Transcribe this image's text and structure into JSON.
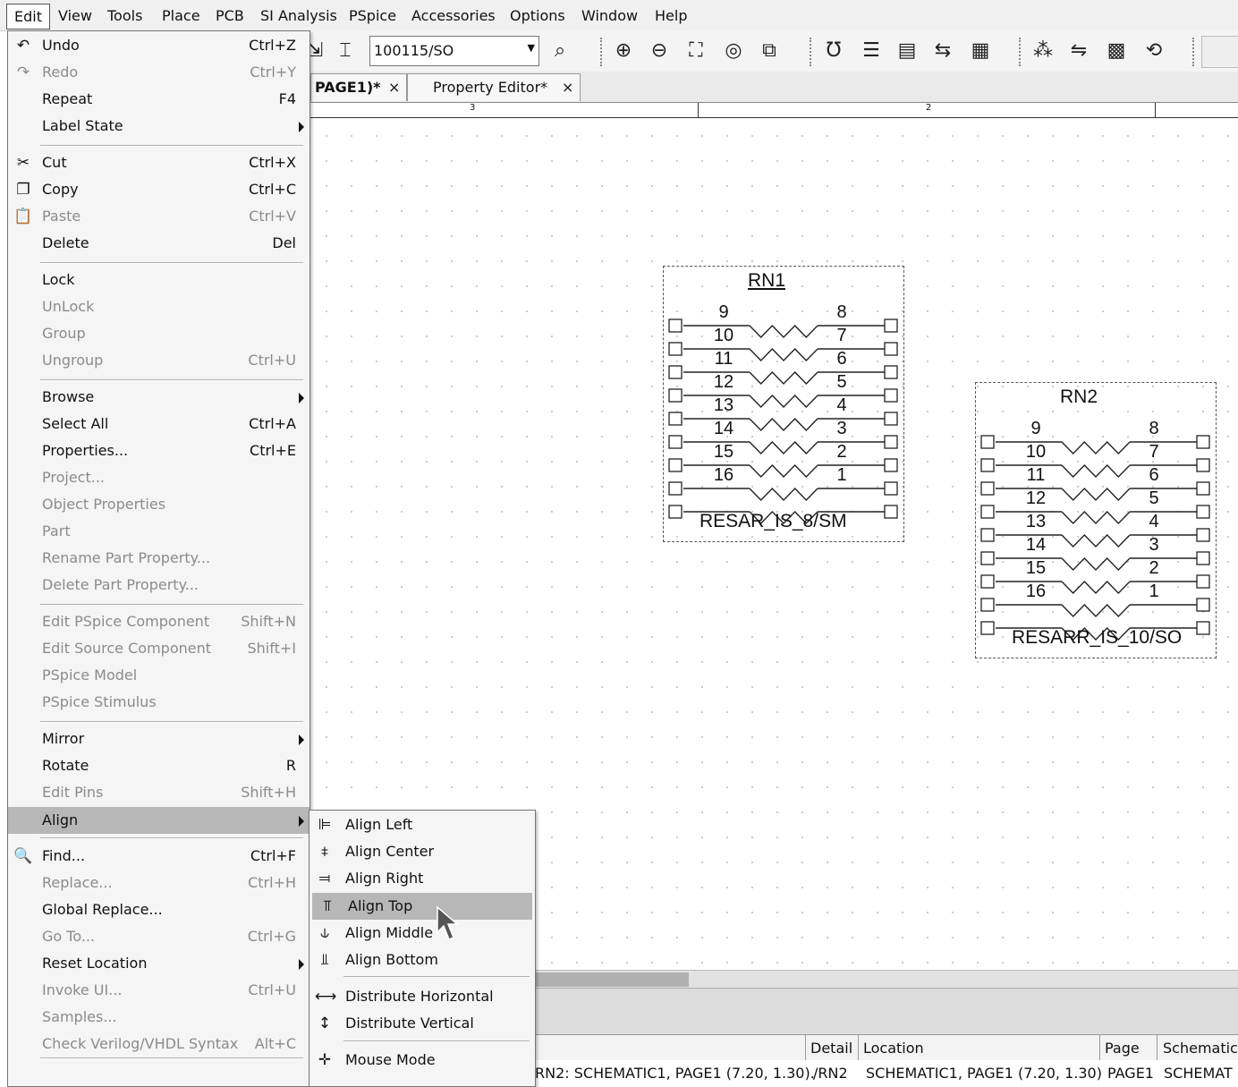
{
  "menubar": {
    "items": [
      "Edit",
      "View",
      "Tools",
      "Place",
      "PCB",
      "SI Analysis",
      "PSpice",
      "Accessories",
      "Options",
      "Window",
      "Help"
    ]
  },
  "toolbar": {
    "part_combo_value": "100115/SO",
    "icons": [
      "place-part-icon",
      "place-pin-icon",
      "find-part-icon",
      "zoom-in-icon",
      "zoom-out-icon",
      "zoom-area-icon",
      "zoom-all-icon",
      "zoom-region-icon",
      "annotate-icon",
      "backannotate-icon",
      "drc-icon",
      "netlist-icon",
      "bom-icon",
      "cross-probe-icon",
      "pcb-editor-icon",
      "constraint-manager-icon",
      "update-icon"
    ]
  },
  "tabs": [
    {
      "label": "PAGE1)*",
      "close": "×"
    },
    {
      "label": "Property Editor*",
      "close": "×"
    }
  ],
  "ruler": {
    "labels": [
      "3",
      "2"
    ]
  },
  "parts": [
    {
      "refdes": "RN1",
      "name": "RESAR_IS_8/SM",
      "left_pins": [
        "9",
        "10",
        "11",
        "12",
        "13",
        "14",
        "15",
        "16"
      ],
      "right_pins": [
        "8",
        "7",
        "6",
        "5",
        "4",
        "3",
        "2",
        "1"
      ]
    },
    {
      "refdes": "RN2",
      "name": "RESARR_IS_10/SO",
      "left_pins": [
        "9",
        "10",
        "11",
        "12",
        "13",
        "14",
        "15",
        "16"
      ],
      "right_pins": [
        "8",
        "7",
        "6",
        "5",
        "4",
        "3",
        "2",
        "1"
      ]
    }
  ],
  "edit_menu": {
    "items": [
      {
        "label": "Undo",
        "shortcut": "Ctrl+Z",
        "icon": "↶",
        "disabled": false
      },
      {
        "label": "Redo",
        "shortcut": "Ctrl+Y",
        "icon": "↷",
        "disabled": true
      },
      {
        "label": "Repeat",
        "shortcut": "F4",
        "disabled": false
      },
      {
        "label": "Label State",
        "shortcut": "",
        "submenu": true,
        "disabled": false
      },
      {
        "label": "Cut",
        "shortcut": "Ctrl+X",
        "icon": "✂",
        "disabled": false
      },
      {
        "label": "Copy",
        "shortcut": "Ctrl+C",
        "icon": "❐",
        "disabled": false
      },
      {
        "label": "Paste",
        "shortcut": "Ctrl+V",
        "icon": "📋",
        "disabled": true
      },
      {
        "label": "Delete",
        "shortcut": "Del",
        "disabled": false
      },
      {
        "label": "Lock",
        "shortcut": "",
        "disabled": false
      },
      {
        "label": "UnLock",
        "shortcut": "",
        "disabled": true
      },
      {
        "label": "Group",
        "shortcut": "",
        "disabled": true
      },
      {
        "label": "Ungroup",
        "shortcut": "Ctrl+U",
        "disabled": true
      },
      {
        "label": "Browse",
        "shortcut": "",
        "submenu": true,
        "disabled": false
      },
      {
        "label": "Select All",
        "shortcut": "Ctrl+A",
        "disabled": false
      },
      {
        "label": "Properties...",
        "shortcut": "Ctrl+E",
        "disabled": false
      },
      {
        "label": "Project...",
        "shortcut": "",
        "disabled": true
      },
      {
        "label": "Object Properties",
        "shortcut": "",
        "disabled": true
      },
      {
        "label": "Part",
        "shortcut": "",
        "disabled": true
      },
      {
        "label": "Rename Part Property...",
        "shortcut": "",
        "disabled": true
      },
      {
        "label": "Delete Part Property...",
        "shortcut": "",
        "disabled": true
      },
      {
        "label": "Edit PSpice Component",
        "shortcut": "Shift+N",
        "disabled": true
      },
      {
        "label": "Edit Source Component",
        "shortcut": "Shift+I",
        "disabled": true
      },
      {
        "label": "PSpice Model",
        "shortcut": "",
        "disabled": true
      },
      {
        "label": "PSpice Stimulus",
        "shortcut": "",
        "disabled": true
      },
      {
        "label": "Mirror",
        "shortcut": "",
        "submenu": true,
        "disabled": false
      },
      {
        "label": "Rotate",
        "shortcut": "R",
        "disabled": false
      },
      {
        "label": "Edit Pins",
        "shortcut": "Shift+H",
        "disabled": true
      },
      {
        "label": "Align",
        "shortcut": "",
        "submenu": true,
        "disabled": false,
        "highlighted": true
      },
      {
        "label": "Find...",
        "shortcut": "Ctrl+F",
        "icon": "🔍",
        "disabled": false
      },
      {
        "label": "Replace...",
        "shortcut": "Ctrl+H",
        "disabled": true
      },
      {
        "label": "Global Replace...",
        "shortcut": "",
        "disabled": false
      },
      {
        "label": "Go To...",
        "shortcut": "Ctrl+G",
        "disabled": true
      },
      {
        "label": "Reset Location",
        "shortcut": "",
        "submenu": true,
        "disabled": false
      },
      {
        "label": "Invoke UI...",
        "shortcut": "Ctrl+U",
        "disabled": true
      },
      {
        "label": "Samples...",
        "shortcut": "",
        "disabled": true
      },
      {
        "label": "Check Verilog/VHDL Syntax",
        "shortcut": "Alt+C",
        "disabled": true
      }
    ]
  },
  "align_menu": {
    "items": [
      {
        "label": "Align Left",
        "icon": "align-left-icon"
      },
      {
        "label": "Align Center",
        "icon": "align-center-icon"
      },
      {
        "label": "Align Right",
        "icon": "align-right-icon"
      },
      {
        "label": "Align Top",
        "icon": "align-top-icon",
        "highlighted": true
      },
      {
        "label": "Align Middle",
        "icon": "align-middle-icon"
      },
      {
        "label": "Align Bottom",
        "icon": "align-bottom-icon"
      },
      {
        "label": "Distribute Horizontal",
        "icon": "distribute-horizontal-icon"
      },
      {
        "label": "Distribute Vertical",
        "icon": "distribute-vertical-icon"
      },
      {
        "label": "Mouse Mode",
        "icon": "mouse-mode-icon"
      }
    ]
  },
  "results_grid": {
    "headers": [
      "Detail",
      "Location",
      "Page",
      "Schematic"
    ],
    "row": {
      "message": "RN2: SCHEMATIC1, PAGE1 (7.20, 1.30).",
      "detail": "/RN2",
      "location": "SCHEMATIC1, PAGE1  (7.20, 1.30)",
      "page": "PAGE1",
      "schematic": "SCHEMAT"
    }
  }
}
